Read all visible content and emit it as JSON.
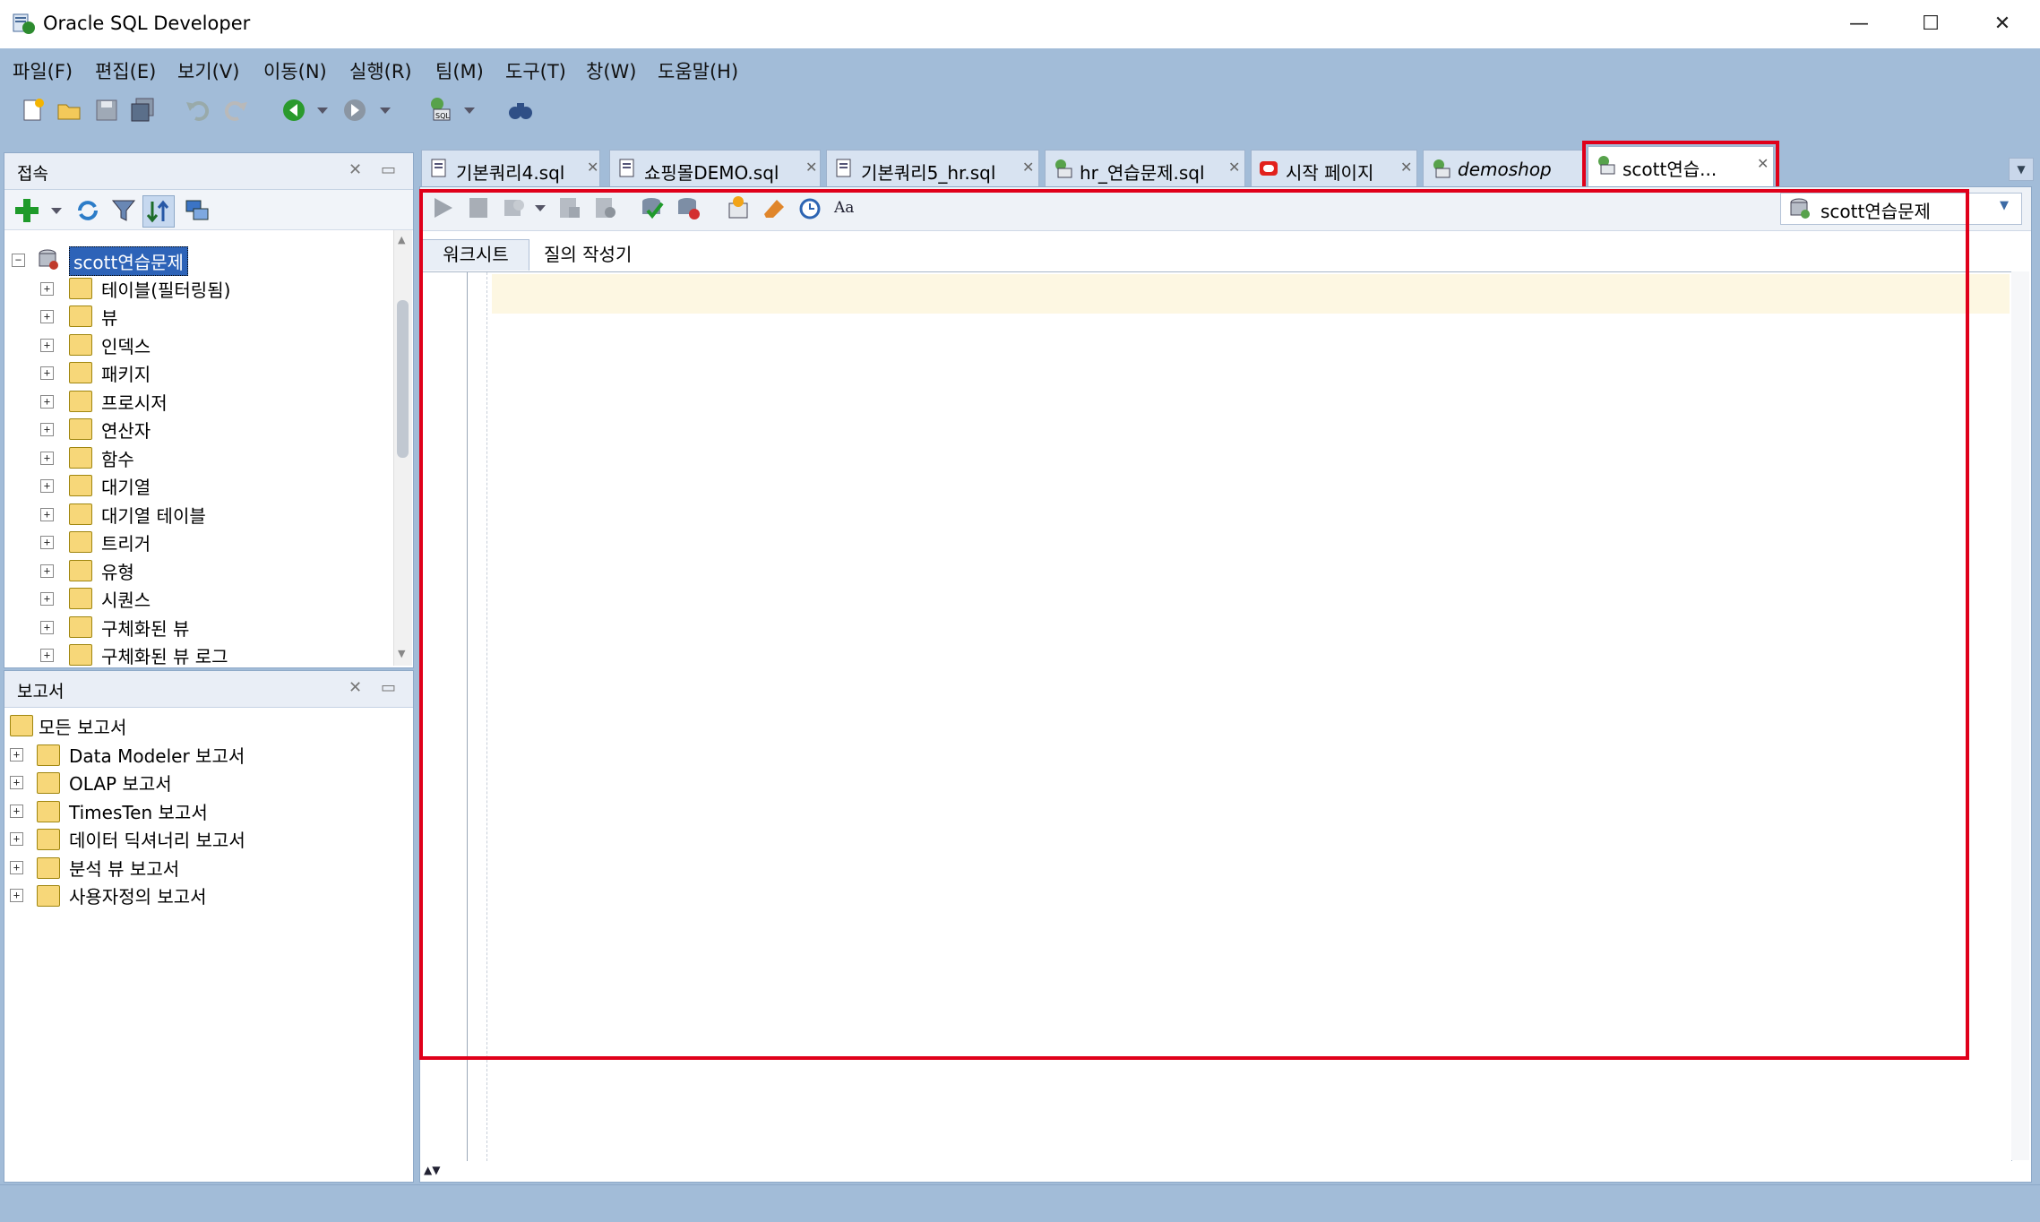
{
  "window": {
    "title": "Oracle SQL Developer",
    "minimize": "—",
    "maximize": "☐",
    "close": "✕"
  },
  "menu": [
    "파일(F)",
    "편집(E)",
    "보기(V)",
    "이동(N)",
    "실행(R)",
    "팀(M)",
    "도구(T)",
    "창(W)",
    "도움말(H)"
  ],
  "connections_panel": {
    "title": "접속",
    "connection_name": "scott연습문제",
    "nodes": [
      "테이블(필터링됨)",
      "뷰",
      "인덱스",
      "패키지",
      "프로시저",
      "연산자",
      "함수",
      "대기열",
      "대기열 테이블",
      "트리거",
      "유형",
      "시퀀스",
      "구체화된 뷰",
      "구체화된 뷰 로그"
    ]
  },
  "reports_panel": {
    "title": "보고서",
    "root": "모든 보고서",
    "items": [
      "Data Modeler 보고서",
      "OLAP 보고서",
      "TimesTen 보고서",
      "데이터 딕셔너리 보고서",
      "분석 뷰 보고서",
      "사용자정의 보고서"
    ]
  },
  "tabs": [
    {
      "label": "기본쿼리4.sql"
    },
    {
      "label": "쇼핑몰DEMO.sql"
    },
    {
      "label": "기본쿼리5_hr.sql"
    },
    {
      "label": "hr_연습문제.sql"
    },
    {
      "label": "시작 페이지"
    },
    {
      "label": "demoshop"
    },
    {
      "label": "scott연습..."
    }
  ],
  "editor": {
    "connection_selector": "scott연습문제",
    "subtabs": [
      "워크시트",
      "질의 작성기"
    ]
  },
  "colors": {
    "highlight": "#e0001a",
    "frame": "#a2bcd8"
  }
}
